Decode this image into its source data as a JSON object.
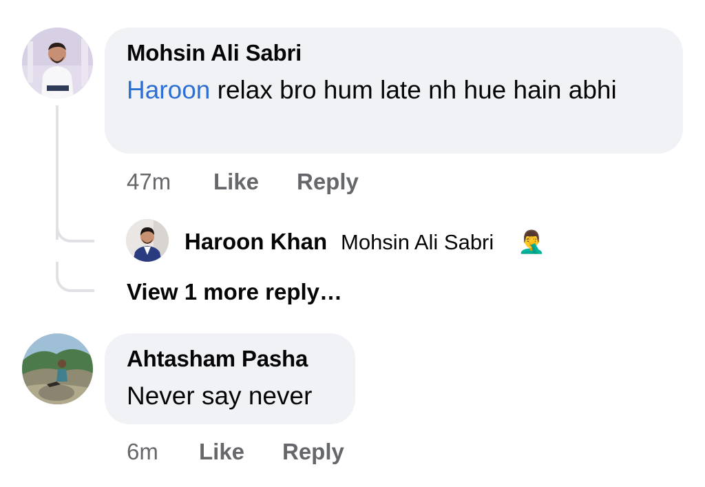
{
  "comments": [
    {
      "author": "Mohsin Ali Sabri",
      "mention": "Haroon",
      "text": " relax bro hum late nh hue hain abhi",
      "time": "47m",
      "like_label": "Like",
      "reply_label": "Reply",
      "avatar_icon": "person-photo"
    },
    {
      "author": "Ahtasham Pasha",
      "text": "Never say never",
      "time": "6m",
      "like_label": "Like",
      "reply_label": "Reply",
      "avatar_icon": "landscape-photo"
    }
  ],
  "reply_preview": {
    "author": "Haroon Khan",
    "text": "Mohsin Ali Sabri",
    "emoji": "🤦‍♂️"
  },
  "view_more_label": "View 1 more reply…",
  "colors": {
    "bubble": "#f0f2f5",
    "mention": "#2d6fd2",
    "meta": "#65676b",
    "thread_line": "#dfe1e5"
  }
}
